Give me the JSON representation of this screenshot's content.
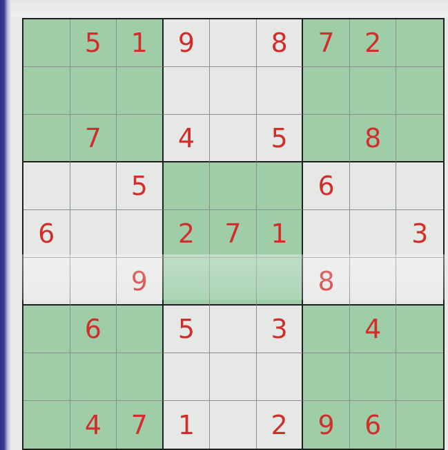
{
  "puzzle": {
    "grid": [
      [
        "",
        "5",
        "1",
        "9",
        "",
        "8",
        "7",
        "2",
        ""
      ],
      [
        "",
        "",
        "",
        "",
        "",
        "",
        "",
        "",
        ""
      ],
      [
        "",
        "7",
        "",
        "4",
        "",
        "5",
        "",
        "8",
        ""
      ],
      [
        "",
        "",
        "5",
        "",
        "",
        "",
        "6",
        "",
        ""
      ],
      [
        "6",
        "",
        "",
        "2",
        "7",
        "1",
        "",
        "",
        "3"
      ],
      [
        "",
        "",
        "9",
        "",
        "",
        "",
        "8",
        "",
        ""
      ],
      [
        "",
        "6",
        "",
        "5",
        "",
        "3",
        "",
        "4",
        ""
      ],
      [
        "",
        "",
        "",
        "",
        "",
        "",
        "",
        "",
        ""
      ],
      [
        "",
        "4",
        "7",
        "1",
        "",
        "2",
        "9",
        "6",
        ""
      ]
    ]
  },
  "colors": {
    "digit": "#cf2e2b",
    "box_green": "#9ecda8",
    "box_white": "#e6e8e6",
    "grid_line": "#1d1f1e"
  }
}
